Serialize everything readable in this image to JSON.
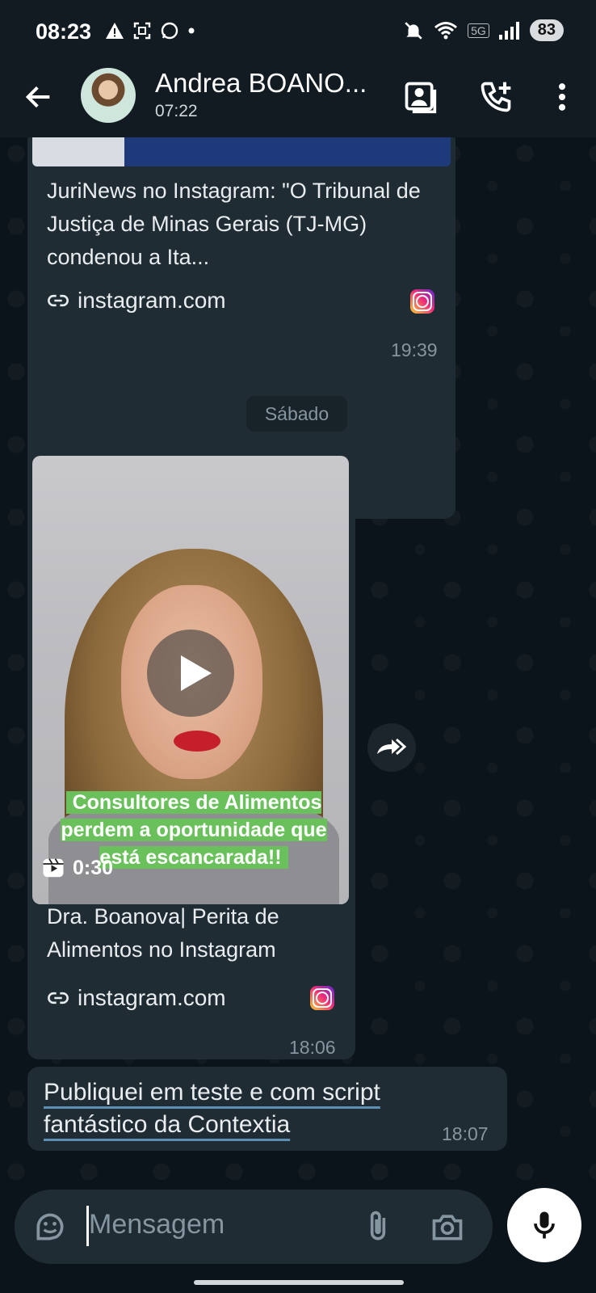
{
  "status_bar": {
    "time": "08:23",
    "network": "5G",
    "battery": "83"
  },
  "header": {
    "contact_name": "Andrea BOANO...",
    "subtitle": "07:22"
  },
  "messages": [
    {
      "type": "link",
      "title": "JuriNews no Instagram: \"O Tribunal de Justiça de Minas Gerais (TJ-MG) condenou a Ita...",
      "domain": "instagram.com",
      "time": "19:39"
    },
    {
      "type": "date_separator",
      "label": "Sábado"
    },
    {
      "type": "video_link",
      "video_caption": "Consultores de Alimentos perdem a oportunidade que está escancarada!!",
      "duration": "0:30",
      "title": "Dra. Boanova| Perita de Alimentos no Instagram",
      "domain": "instagram.com",
      "time": "18:06"
    },
    {
      "type": "text",
      "text_line1": "Publiquei em teste e com script",
      "text_line2": "fantástico da Contextia",
      "time": "18:07"
    }
  ],
  "input": {
    "placeholder": "Mensagem"
  },
  "colors": {
    "bubble": "#1f2c34",
    "background": "#0b141a",
    "header": "#111b21",
    "meta_text": "#8696a0"
  },
  "icons": [
    "back-arrow-icon",
    "contact-card-icon",
    "add-call-icon",
    "more-vert-icon",
    "link-icon",
    "instagram-icon",
    "play-icon",
    "reel-icon",
    "forward-icon",
    "sticker-icon",
    "attach-icon",
    "camera-icon",
    "mic-icon"
  ]
}
